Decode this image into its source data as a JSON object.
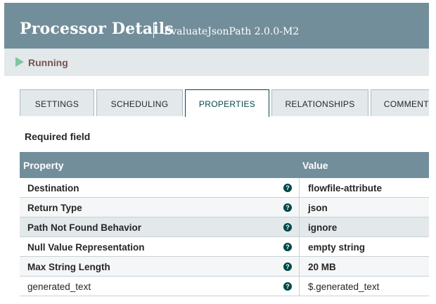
{
  "header": {
    "title": "Processor Details",
    "subtitle": "EvaluateJsonPath 2.0.0-M2"
  },
  "status": {
    "label": "Running",
    "icon": "play-icon",
    "icon_color": "#7dc7a0"
  },
  "tabs": [
    {
      "label": "SETTINGS"
    },
    {
      "label": "SCHEDULING"
    },
    {
      "label": "PROPERTIES"
    },
    {
      "label": "RELATIONSHIPS"
    },
    {
      "label": "COMMENTS"
    }
  ],
  "active_tab": "PROPERTIES",
  "required_label": "Required field",
  "table": {
    "columns": [
      "Property",
      "Value"
    ],
    "rows": [
      {
        "name": "Destination",
        "value": "flowfile-attribute",
        "required": true
      },
      {
        "name": "Return Type",
        "value": "json",
        "required": true
      },
      {
        "name": "Path Not Found Behavior",
        "value": "ignore",
        "required": true
      },
      {
        "name": "Null Value Representation",
        "value": "empty string",
        "required": true
      },
      {
        "name": "Max String Length",
        "value": "20 MB",
        "required": true
      },
      {
        "name": "generated_text",
        "value": "$.generated_text",
        "required": false
      }
    ]
  },
  "colors": {
    "header_bg": "#728e9b",
    "accent": "#004849",
    "status_text": "#775351"
  }
}
